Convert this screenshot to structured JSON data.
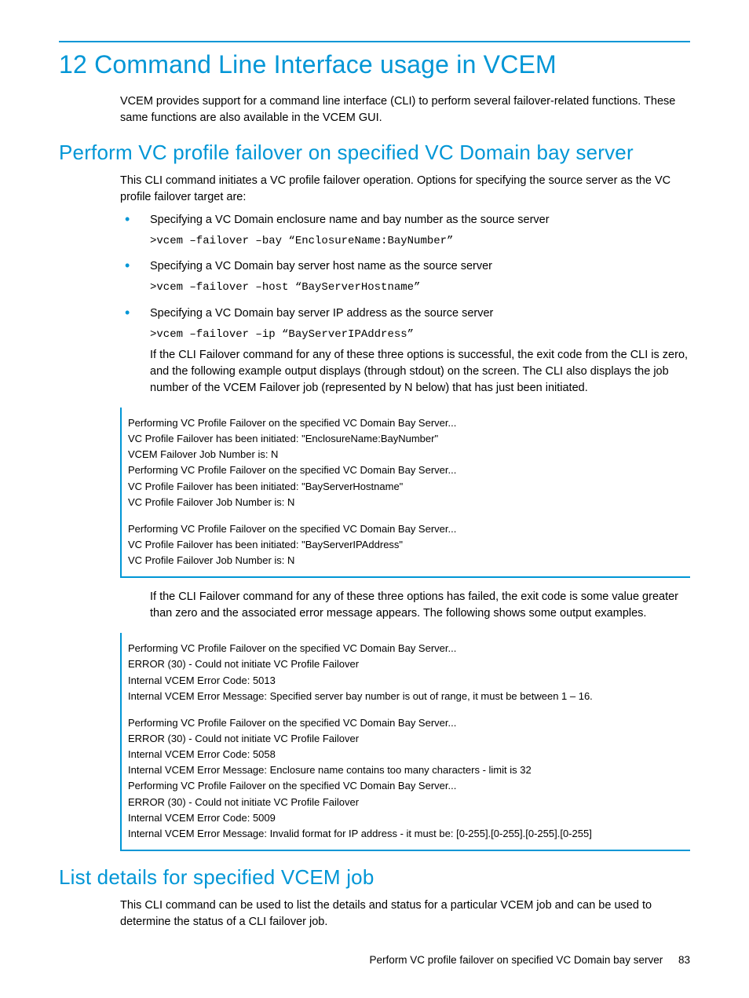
{
  "chapter_title": "12 Command Line Interface usage in VCEM",
  "intro": "VCEM provides support for a command line interface (CLI) to perform several failover-related functions. These same functions are also available in the VCEM GUI.",
  "section1": {
    "title": "Perform VC profile failover on specified VC Domain bay server",
    "intro": "This CLI command initiates a VC profile failover operation. Options for specifying the source server as the VC profile failover target are:",
    "bullets": [
      {
        "text": "Specifying a VC Domain enclosure name and bay number as the source server",
        "cmd": ">vcem –failover –bay “EnclosureName:BayNumber”"
      },
      {
        "text": "Specifying a VC Domain bay server host name as the source server",
        "cmd": ">vcem –failover –host “BayServerHostname”"
      },
      {
        "text": "Specifying a VC Domain bay server IP address as the source server",
        "cmd": ">vcem –failover –ip “BayServerIPAddress”",
        "follow": "If the CLI Failover command for any of these three options is successful, the exit code from the CLI is zero, and the following example output displays (through stdout) on the screen. The CLI also displays the job number of the VCEM Failover job (represented by N below) that has just been initiated."
      }
    ],
    "output1": [
      "Performing VC Profile Failover on the specified VC Domain Bay Server...",
      "VC Profile Failover has been initiated: \"EnclosureName:BayNumber\"",
      "VCEM Failover Job Number is: N",
      "Performing VC Profile Failover on the specified VC Domain Bay Server...",
      "VC Profile Failover has been initiated: \"BayServerHostname\"",
      "VC Profile Failover Job Number is: N",
      "",
      "Performing VC Profile Failover on the specified VC Domain Bay Server...",
      "VC Profile Failover has been initiated: \"BayServerIPAddress\"",
      "VC Profile Failover Job Number is: N"
    ],
    "mid_para": "If the CLI Failover command for any of these three options has failed, the exit code is some value greater than zero and the associated error message appears. The following shows some output examples.",
    "output2": [
      "Performing VC Profile Failover on the specified VC Domain Bay Server...",
      "ERROR (30) - Could not initiate VC Profile Failover",
      "Internal VCEM Error Code: 5013",
      "Internal VCEM Error Message: Specified server bay number is out of range, it must be between 1 – 16.",
      "",
      "Performing VC Profile Failover on the specified VC Domain Bay Server...",
      "ERROR (30) - Could not initiate VC Profile Failover",
      "Internal VCEM Error Code: 5058",
      "Internal VCEM Error Message: Enclosure name contains too many characters - limit is 32",
      "Performing VC Profile Failover on the specified VC Domain Bay Server...",
      "ERROR (30) - Could not initiate VC Profile Failover",
      "Internal VCEM Error Code: 5009",
      "Internal VCEM Error Message: Invalid format for IP address - it must be: [0-255].[0-255].[0-255].[0-255]"
    ]
  },
  "section2": {
    "title": "List details for specified VCEM job",
    "intro": "This CLI command can be used to list the details and status for a particular VCEM job and can be used to determine the status of a CLI failover job."
  },
  "footer": {
    "text": "Perform VC profile failover on specified VC Domain bay server",
    "page": "83"
  }
}
